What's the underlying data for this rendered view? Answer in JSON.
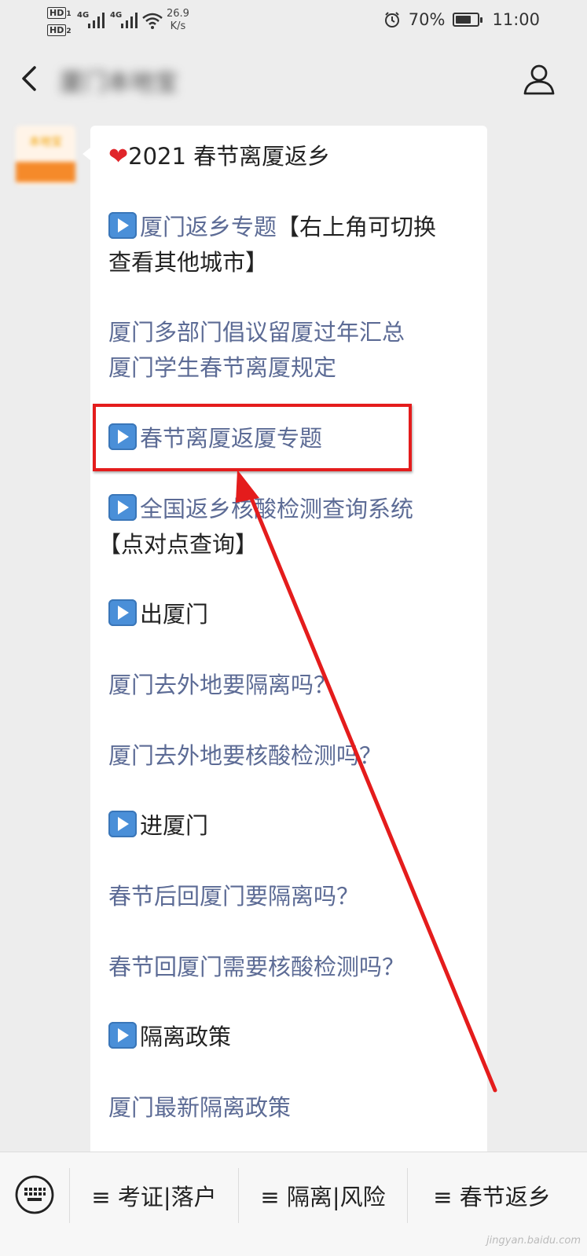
{
  "status_bar": {
    "hd1": "HD",
    "hd1_sub": "1",
    "hd2": "HD",
    "hd2_sub": "2",
    "net1": "4G",
    "net2": "4G",
    "speed_value": "26.9",
    "speed_unit": "K/s",
    "battery_pct": "70%",
    "battery_level": 0.7,
    "time": "11:00"
  },
  "nav": {
    "title": "厦门本地宝"
  },
  "avatar": {
    "label": "本地宝"
  },
  "message": {
    "heading": "2021 春节离厦返乡",
    "line1_link": "厦门返乡专题",
    "line1_rest": "【右上角可切换",
    "line2": "查看其他城市】",
    "link_a": "厦门多部门倡议留厦过年汇总",
    "link_b": "厦门学生春节离厦规定",
    "highlight_link": "春节离厦返厦专题",
    "link_c1": "全国返乡核酸检测查询系统",
    "link_c2": "【点对点查询】",
    "section_out": "出厦门",
    "link_d": "厦门去外地要隔离吗？",
    "link_e": "厦门去外地要核酸检测吗？",
    "section_in": "进厦门",
    "link_f": "春节后回厦门要隔离吗？",
    "link_g": "春节回厦门需要核酸检测吗？",
    "section_policy": "隔离政策",
    "link_h": "厦门最新隔离政策"
  },
  "menu": {
    "items": [
      {
        "label": "≡ 考证|落户"
      },
      {
        "label": "≡ 隔离|风险"
      },
      {
        "label": "≡ 春节返乡"
      }
    ]
  },
  "watermark": "jingyan.baidu.com",
  "colors": {
    "link": "#5c6b95",
    "annotation": "#e41c1c",
    "play_icon": "#4a8fd8"
  }
}
